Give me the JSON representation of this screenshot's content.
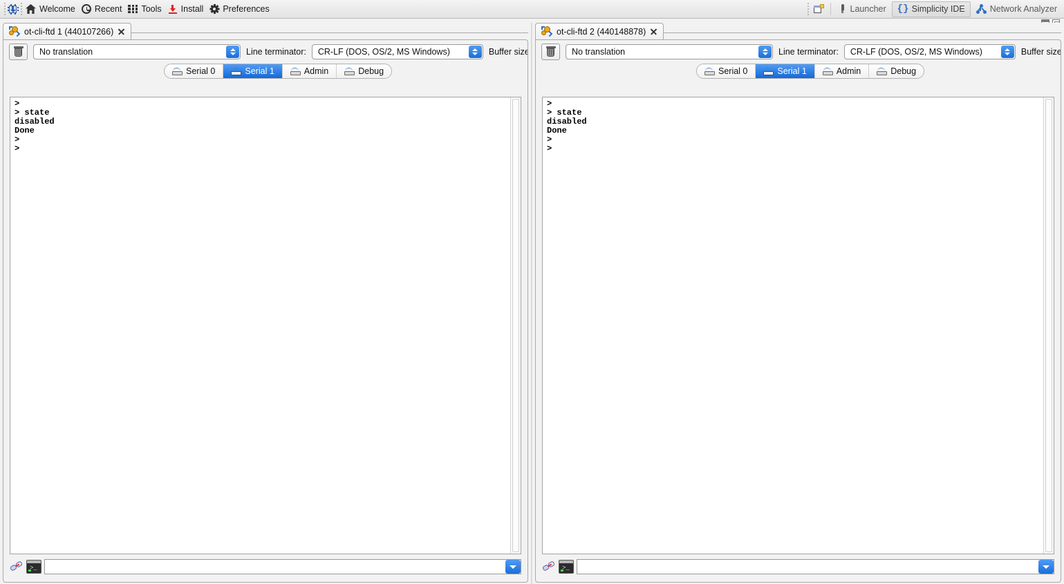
{
  "toolbar": {
    "chip_icon": "chip-icon",
    "items": [
      {
        "label": "Welcome",
        "icon": "home-icon"
      },
      {
        "label": "Recent",
        "icon": "clock-icon"
      },
      {
        "label": "Tools",
        "icon": "grid-icon"
      },
      {
        "label": "Install",
        "icon": "download-icon"
      },
      {
        "label": "Preferences",
        "icon": "gear-icon"
      }
    ],
    "new_perspective_icon": "new-perspective-icon",
    "perspectives": [
      {
        "label": "Launcher",
        "icon": "rocket-icon",
        "active": false
      },
      {
        "label": "Simplicity IDE",
        "icon": "braces-icon",
        "active": true
      },
      {
        "label": "Network Analyzer",
        "icon": "network-icon",
        "active": false
      }
    ],
    "window_controls": [
      "minimize-icon",
      "maximize-icon"
    ]
  },
  "panels": [
    {
      "id": "left",
      "tab": {
        "title": "ot-cli-ftd 1 (440107266)",
        "icon": "gears-icon",
        "close": "close-icon"
      },
      "controls": {
        "clear_icon": "trash-icon",
        "translation": "No translation",
        "line_terminator_label": "Line terminator:",
        "line_terminator": "CR-LF  (DOS, OS/2, MS Windows)",
        "buffer_size_label": "Buffer size"
      },
      "serial_tabs": [
        {
          "label": "Serial 0",
          "selected": false
        },
        {
          "label": "Serial 1",
          "selected": true
        },
        {
          "label": "Admin",
          "selected": false
        },
        {
          "label": "Debug",
          "selected": false
        }
      ],
      "console": ">\n> state\ndisabled\nDone\n>\n>",
      "input": {
        "connection_icon": "disconnected-plug-icon",
        "terminal_icon": "terminal-icon",
        "value": "",
        "placeholder": "",
        "dropdown_icon": "chevron-down-icon"
      }
    },
    {
      "id": "right",
      "tab": {
        "title": "ot-cli-ftd 2 (440148878)",
        "icon": "gears-icon",
        "close": "close-icon"
      },
      "controls": {
        "clear_icon": "trash-icon",
        "translation": "No translation",
        "line_terminator_label": "Line terminator:",
        "line_terminator": "CR-LF  (DOS, OS/2, MS Windows)",
        "buffer_size_label": "Buffer size"
      },
      "serial_tabs": [
        {
          "label": "Serial 0",
          "selected": false
        },
        {
          "label": "Serial 1",
          "selected": true
        },
        {
          "label": "Admin",
          "selected": false
        },
        {
          "label": "Debug",
          "selected": false
        }
      ],
      "console": ">\n> state\ndisabled\nDone\n>\n>",
      "input": {
        "connection_icon": "disconnected-plug-icon",
        "terminal_icon": "terminal-icon",
        "value": "",
        "placeholder": "",
        "dropdown_icon": "chevron-down-icon"
      }
    }
  ],
  "colors": {
    "accent_blue": "#1b6ed8",
    "selected_tab": "#2f7fe0",
    "toolbar_bg": "#eaeaea",
    "console_bg": "#ffffff",
    "console_fg": "#000000"
  }
}
